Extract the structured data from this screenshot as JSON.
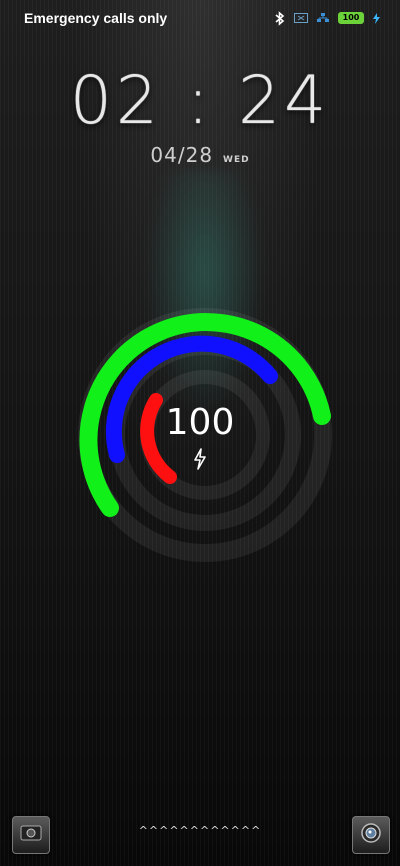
{
  "status_bar": {
    "carrier_text": "Emergency calls only",
    "battery_level": "100",
    "icons": [
      "bluetooth-icon",
      "sim-icon",
      "network-icon",
      "battery-icon",
      "charging-icon"
    ]
  },
  "lock_screen": {
    "time": "02:24",
    "date": "04/28",
    "day": "WED",
    "battery_value": "100",
    "unlock_hint": "^^^^^^^^^^^^"
  },
  "gauge": {
    "outer_arc_color": "#12f01a",
    "middle_arc_color": "#1010ff",
    "inner_arc_color": "#ff1010"
  },
  "shortcuts": {
    "left_icon": "gallery-icon",
    "right_icon": "camera-icon"
  }
}
